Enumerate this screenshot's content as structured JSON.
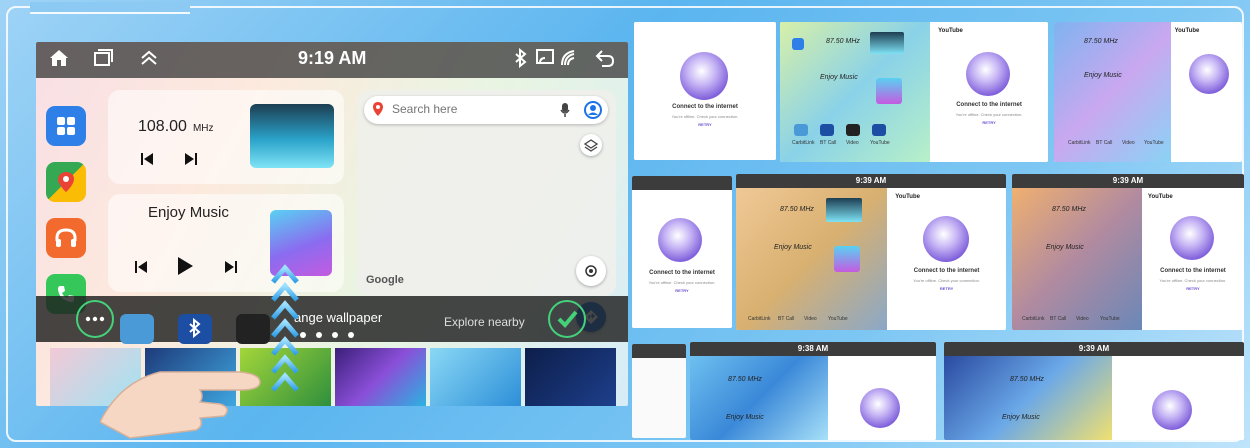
{
  "main_screen": {
    "status_bar": {
      "time": "9:19 AM",
      "icons": [
        "home-icon",
        "recent-apps-icon",
        "chevron-up-icon",
        "bluetooth-icon",
        "cast-icon",
        "phone-link-icon",
        "back-icon"
      ]
    },
    "dock_apps": [
      "app-grid",
      "google-maps",
      "podcasts",
      "phone"
    ],
    "radio": {
      "frequency": "108.00",
      "unit": "MHz"
    },
    "music": {
      "title": "Enjoy Music"
    },
    "map": {
      "search_placeholder": "Search here",
      "brand": "Google"
    },
    "wallpaper_panel": {
      "title": "ange wallpaper",
      "explore": "Explore nearby"
    }
  },
  "thumbnails": {
    "times": [
      "9:39 AM",
      "9:39 AM",
      "9:38 AM",
      "9:39 AM"
    ],
    "freq": "87.50",
    "freq_unit": "MHz",
    "music": "Enjoy Music",
    "youtube": "YouTube",
    "connect": "Connect to the internet",
    "offline": "You're offline. Check your connection.",
    "retry": "RETRY",
    "apps": [
      "CarbitLink",
      "BT Call",
      "Video",
      "YouTube"
    ]
  },
  "colors": {
    "frame_blue": "#5bb5ef",
    "accent_green": "#43d27a",
    "map_blue": "#1a73e8"
  }
}
